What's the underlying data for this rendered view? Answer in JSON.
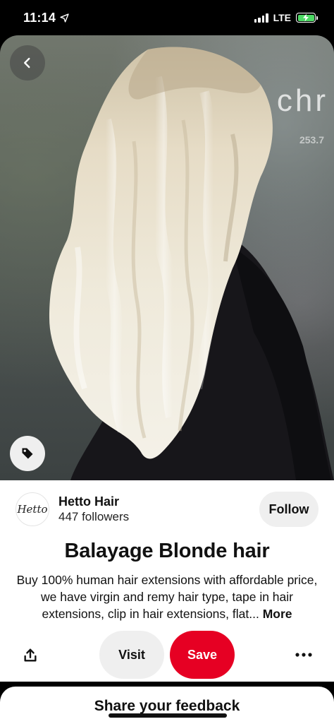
{
  "status_bar": {
    "time": "11:14",
    "network": "LTE",
    "battery_color": "#4cd964"
  },
  "image": {
    "shop_sign": "chr",
    "shop_sign_sub": "253.7",
    "back_icon": "chevron-left-icon",
    "tag_icon": "tag-icon"
  },
  "creator": {
    "avatar_text": "Hetto",
    "name": "Hetto Hair",
    "followers": "447 followers",
    "follow_label": "Follow"
  },
  "pin": {
    "title": "Balayage Blonde hair",
    "description": "Buy 100% human hair extensions with affordable price, we have virgin and remy hair type, tape in hair extensions, clip in hair extensions, flat...",
    "more_label": "More"
  },
  "actions": {
    "share_icon": "share-icon",
    "visit_label": "Visit",
    "save_label": "Save",
    "more_icon": "ellipsis-icon",
    "save_color": "#e60023"
  },
  "feedback": {
    "label": "Share your feedback"
  }
}
